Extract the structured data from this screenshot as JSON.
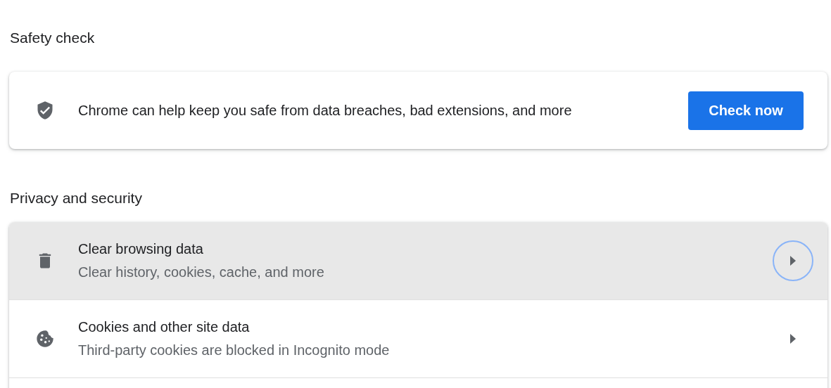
{
  "safety_check": {
    "title": "Safety check",
    "message": "Chrome can help keep you safe from data breaches, bad extensions, and more",
    "button": "Check now"
  },
  "privacy": {
    "title": "Privacy and security",
    "items": [
      {
        "kind": "trash",
        "title": "Clear browsing data",
        "subtitle": "Clear history, cookies, cache, and more",
        "focused": true
      },
      {
        "kind": "cookie",
        "title": "Cookies and other site data",
        "subtitle": "Third-party cookies are blocked in Incognito mode",
        "focused": false
      }
    ]
  }
}
